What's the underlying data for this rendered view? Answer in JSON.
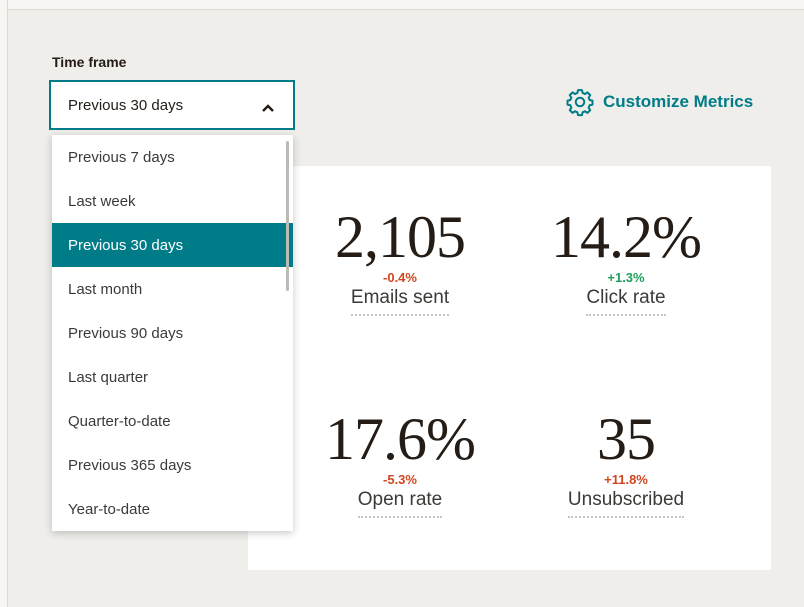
{
  "timeframe": {
    "label": "Time frame",
    "selected": "Previous 30 days",
    "options": [
      "Previous 7 days",
      "Last week",
      "Previous 30 days",
      "Last month",
      "Previous 90 days",
      "Last quarter",
      "Quarter-to-date",
      "Previous 365 days",
      "Year-to-date"
    ]
  },
  "customize": {
    "label": "Customize Metrics",
    "icon": "gear-icon"
  },
  "metrics": [
    {
      "value": "2,105",
      "change": "-0.4%",
      "direction": "down",
      "label": "Emails sent"
    },
    {
      "value": "14.2%",
      "change": "+1.3%",
      "direction": "up",
      "label": "Click rate"
    },
    {
      "value": "17.6%",
      "change": "-5.3%",
      "direction": "down",
      "label": "Open rate"
    },
    {
      "value": "35",
      "change": "+11.8%",
      "direction": "down",
      "label": "Unsubscribed"
    }
  ],
  "colors": {
    "accent": "#007c89",
    "negative": "#d0461f",
    "positive": "#1f9e5a",
    "background": "#efeeea"
  }
}
